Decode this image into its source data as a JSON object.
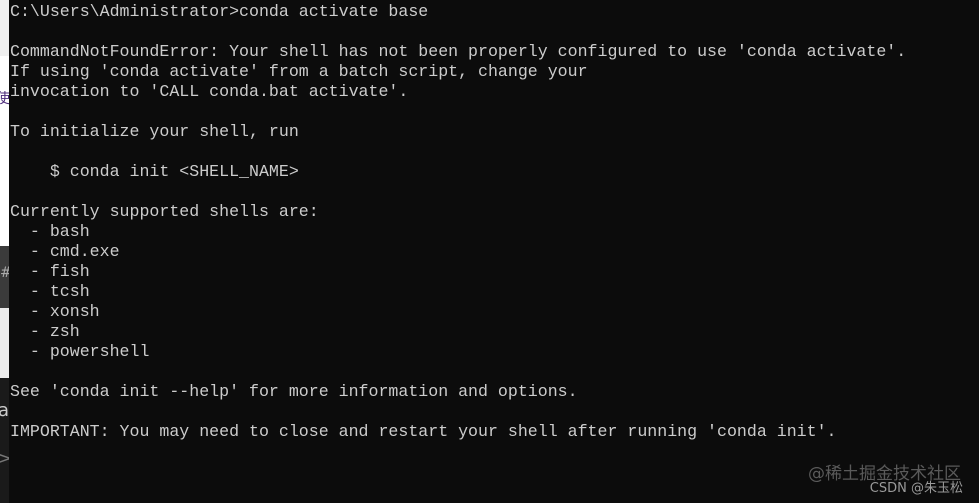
{
  "terminal": {
    "lines": [
      "C:\\Users\\Administrator>conda activate base",
      "",
      "CommandNotFoundError: Your shell has not been properly configured to use 'conda activate'.",
      "If using 'conda activate' from a batch script, change your",
      "invocation to 'CALL conda.bat activate'.",
      "",
      "To initialize your shell, run",
      "",
      "    $ conda init <SHELL_NAME>",
      "",
      "Currently supported shells are:",
      "  - bash",
      "  - cmd.exe",
      "  - fish",
      "  - tcsh",
      "  - xonsh",
      "  - zsh",
      "  - powershell",
      "",
      "See 'conda init --help' for more information and options.",
      "",
      "IMPORTANT: You may need to close and restart your shell after running 'conda init'."
    ]
  },
  "background_window": {
    "glyph_1": "使",
    "glyph_2": "#",
    "glyph_3": "a",
    "glyph_4": ">"
  },
  "watermark": {
    "juejin": "@稀土掘金技术社区",
    "csdn": "CSDN @朱玉松"
  }
}
